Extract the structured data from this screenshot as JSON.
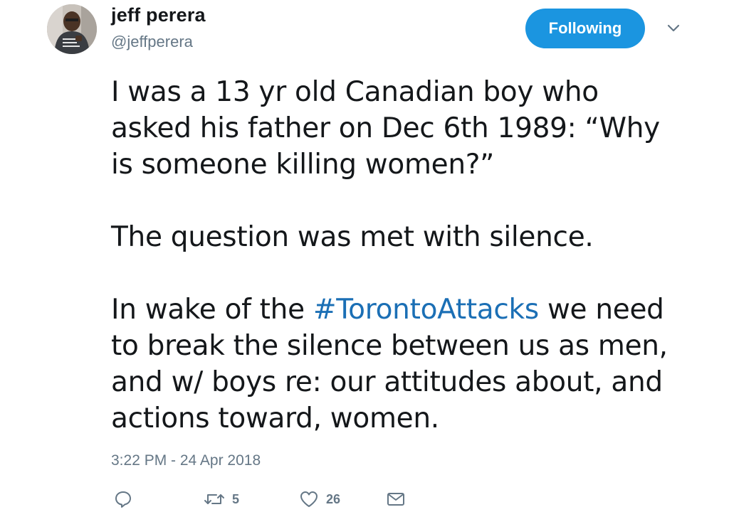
{
  "author": {
    "name": "jeff perera",
    "handle": "@jeffperera",
    "avatar_icon": "profile-photo"
  },
  "follow_button": {
    "label": "Following",
    "color": "#1b95e0"
  },
  "menu": {
    "icon": "chevron-down-icon"
  },
  "tweet": {
    "lines_para1": [
      "I was a 13 yr old Canadian boy who",
      "asked his father on Dec 6th 1989: “Why",
      "is someone killing women?”"
    ],
    "line_para2": "The question was met with silence.",
    "para3_pre": "In wake of the ",
    "hashtag": "#TorontoAttacks",
    "para3_post": " we need",
    "lines_para3": [
      "to break the silence between us as men,",
      "and w/ boys re: our attitudes about, and",
      "actions toward, women."
    ],
    "hashtag_color": "#1b6fb5"
  },
  "timestamp": "3:22 PM - 24 Apr 2018",
  "actions": {
    "reply": {
      "icon": "reply-icon",
      "count": ""
    },
    "retweet": {
      "icon": "retweet-icon",
      "count": "5"
    },
    "like": {
      "icon": "heart-icon",
      "count": "26"
    },
    "message": {
      "icon": "envelope-icon",
      "count": ""
    }
  }
}
